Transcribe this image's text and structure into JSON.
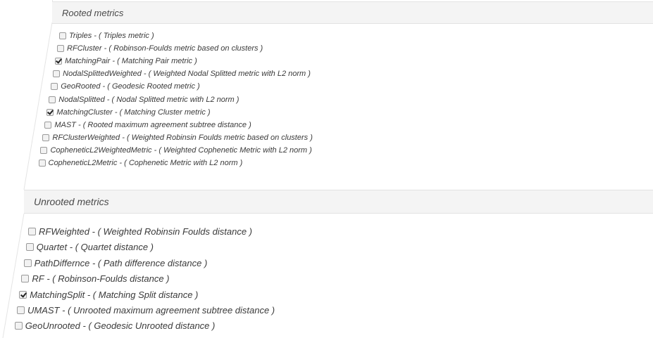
{
  "rooted": {
    "title": "Rooted metrics",
    "items": [
      {
        "name": "Triples",
        "desc": "- ( Triples metric )",
        "checked": false
      },
      {
        "name": "RFCluster",
        "desc": "- ( Robinson-Foulds metric based on clusters )",
        "checked": false
      },
      {
        "name": "MatchingPair",
        "desc": "- ( Matching Pair metric )",
        "checked": true
      },
      {
        "name": "NodalSplittedWeighted",
        "desc": "- ( Weighted Nodal Splitted metric with L2 norm )",
        "checked": false
      },
      {
        "name": "GeoRooted",
        "desc": "- ( Geodesic Rooted metric )",
        "checked": false
      },
      {
        "name": "NodalSplitted",
        "desc": "- ( Nodal Splitted metric with L2 norm )",
        "checked": false
      },
      {
        "name": "MatchingCluster",
        "desc": "- ( Matching Cluster metric )",
        "checked": true
      },
      {
        "name": "MAST",
        "desc": "- ( Rooted maximum agreement subtree distance )",
        "checked": false
      },
      {
        "name": "RFClusterWeighted",
        "desc": "- ( Weighted Robinsin Foulds metric based on clusters )",
        "checked": false
      },
      {
        "name": "CopheneticL2WeightedMetric",
        "desc": "- ( Weighted Cophenetic Metric with L2 norm )",
        "checked": false
      },
      {
        "name": "CopheneticL2Metric",
        "desc": "- ( Cophenetic Metric with L2 norm )",
        "checked": false
      }
    ]
  },
  "unrooted": {
    "title": "Unrooted metrics",
    "items": [
      {
        "name": "RFWeighted",
        "desc": "- ( Weighted Robinsin Foulds distance )",
        "checked": false
      },
      {
        "name": "Quartet",
        "desc": "- ( Quartet distance )",
        "checked": false
      },
      {
        "name": "PathDiffernce",
        "desc": "- ( Path difference distance )",
        "checked": false
      },
      {
        "name": "RF",
        "desc": "- ( Robinson-Foulds distance )",
        "checked": false
      },
      {
        "name": "MatchingSplit",
        "desc": "- ( Matching Split distance )",
        "checked": true
      },
      {
        "name": "UMAST",
        "desc": "- ( Unrooted maximum agreement subtree distance )",
        "checked": false
      },
      {
        "name": "GeoUnrooted",
        "desc": "- ( Geodesic Unrooted distance )",
        "checked": false
      }
    ]
  }
}
